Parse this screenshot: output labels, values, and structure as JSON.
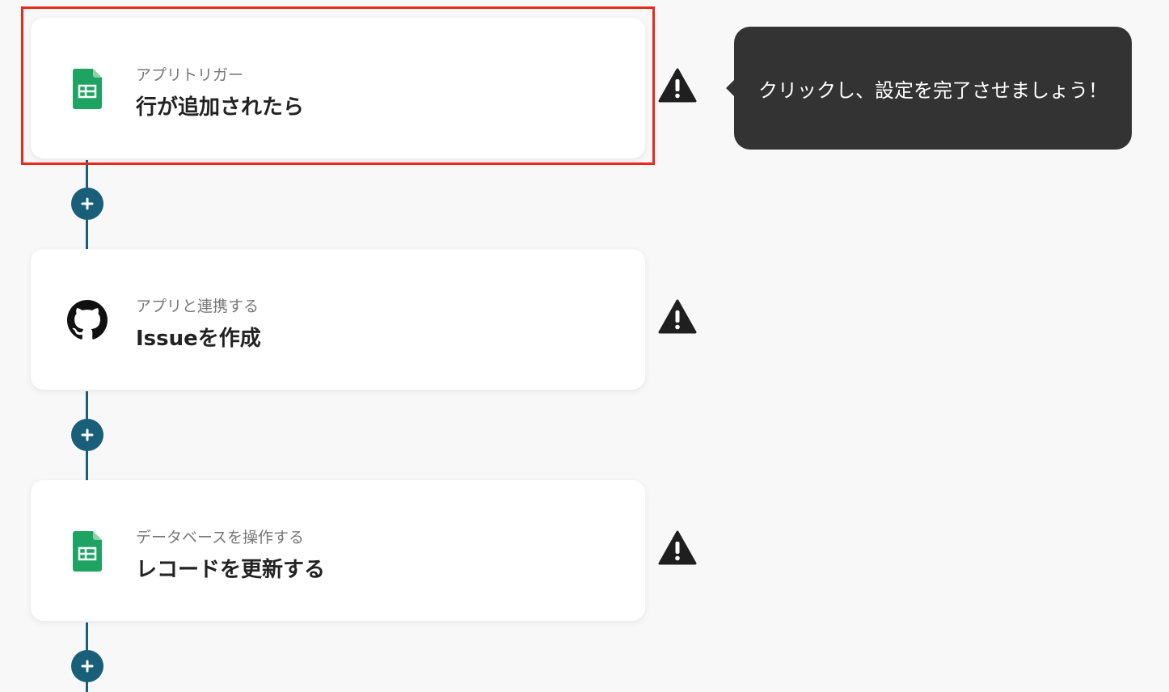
{
  "steps": [
    {
      "label": "アプリトリガー",
      "title": "行が追加されたら",
      "app_icon": "google-sheets-icon"
    },
    {
      "label": "アプリと連携する",
      "title": "Issueを作成",
      "app_icon": "github-icon"
    },
    {
      "label": "データベースを操作する",
      "title": "レコードを更新する",
      "app_icon": "google-sheets-icon"
    }
  ],
  "tooltip": {
    "text": "クリックし、設定を完了させましょう！"
  },
  "icons": {
    "warning": "warning-icon",
    "add": "plus-icon"
  },
  "colors": {
    "connector": "#1a5f7a",
    "selection": "#e8291c",
    "sheets_green": "#1ea362",
    "tooltip_bg": "#333333"
  }
}
